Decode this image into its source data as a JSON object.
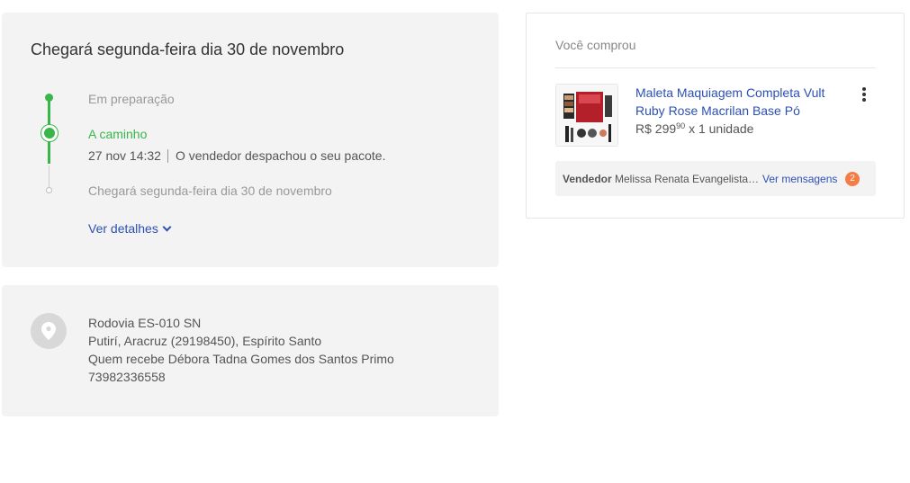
{
  "shipment": {
    "title": "Chegará segunda-feira dia 30 de novembro",
    "steps": [
      {
        "label": "Em preparação",
        "state": "done"
      },
      {
        "label": "A caminho",
        "state": "current",
        "time": "27 nov 14:32",
        "detail": "O vendedor despachou o seu pacote."
      },
      {
        "label": "Chegará segunda-feira dia 30 de novembro",
        "state": "pending"
      }
    ],
    "details_link": "Ver detalhes"
  },
  "address": {
    "icon": "location-pin-icon",
    "line1": "Rodovia ES-010 SN",
    "line2": "Putirí, Aracruz (29198450), Espírito Santo",
    "line3": "Quem recebe Débora Tadna Gomes dos Santos Primo",
    "line4": "73982336558"
  },
  "purchase": {
    "title": "Você comprou",
    "product": {
      "name": "Maleta Maquiagem Completa Vult Ruby Rose Macrilan Base Pó",
      "currency": "R$",
      "price_int": "299",
      "price_cents": "90",
      "quantity_text": "x 1 unidade"
    },
    "seller": {
      "label": "Vendedor",
      "name": "Melissa Renata Evangelista Cardoso",
      "messages_link": "Ver mensagens",
      "unread_count": "2"
    }
  },
  "colors": {
    "green": "#39b54a",
    "link": "#2d50b4",
    "badge": "#f57c42",
    "panel": "#f3f3f3"
  }
}
